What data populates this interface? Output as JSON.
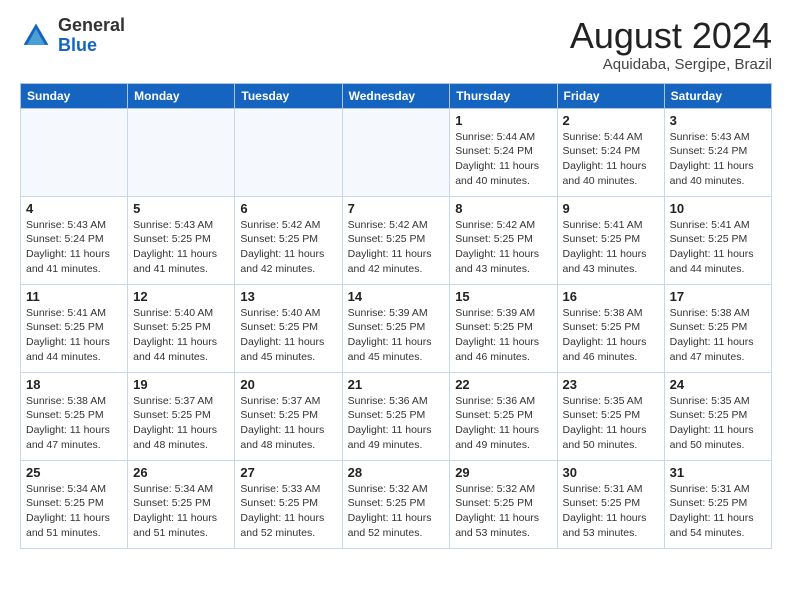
{
  "logo": {
    "general": "General",
    "blue": "Blue"
  },
  "header": {
    "month": "August 2024",
    "location": "Aquidaba, Sergipe, Brazil"
  },
  "weekdays": [
    "Sunday",
    "Monday",
    "Tuesday",
    "Wednesday",
    "Thursday",
    "Friday",
    "Saturday"
  ],
  "weeks": [
    [
      {
        "day": "",
        "info": ""
      },
      {
        "day": "",
        "info": ""
      },
      {
        "day": "",
        "info": ""
      },
      {
        "day": "",
        "info": ""
      },
      {
        "day": "1",
        "info": "Sunrise: 5:44 AM\nSunset: 5:24 PM\nDaylight: 11 hours\nand 40 minutes."
      },
      {
        "day": "2",
        "info": "Sunrise: 5:44 AM\nSunset: 5:24 PM\nDaylight: 11 hours\nand 40 minutes."
      },
      {
        "day": "3",
        "info": "Sunrise: 5:43 AM\nSunset: 5:24 PM\nDaylight: 11 hours\nand 40 minutes."
      }
    ],
    [
      {
        "day": "4",
        "info": "Sunrise: 5:43 AM\nSunset: 5:24 PM\nDaylight: 11 hours\nand 41 minutes."
      },
      {
        "day": "5",
        "info": "Sunrise: 5:43 AM\nSunset: 5:25 PM\nDaylight: 11 hours\nand 41 minutes."
      },
      {
        "day": "6",
        "info": "Sunrise: 5:42 AM\nSunset: 5:25 PM\nDaylight: 11 hours\nand 42 minutes."
      },
      {
        "day": "7",
        "info": "Sunrise: 5:42 AM\nSunset: 5:25 PM\nDaylight: 11 hours\nand 42 minutes."
      },
      {
        "day": "8",
        "info": "Sunrise: 5:42 AM\nSunset: 5:25 PM\nDaylight: 11 hours\nand 43 minutes."
      },
      {
        "day": "9",
        "info": "Sunrise: 5:41 AM\nSunset: 5:25 PM\nDaylight: 11 hours\nand 43 minutes."
      },
      {
        "day": "10",
        "info": "Sunrise: 5:41 AM\nSunset: 5:25 PM\nDaylight: 11 hours\nand 44 minutes."
      }
    ],
    [
      {
        "day": "11",
        "info": "Sunrise: 5:41 AM\nSunset: 5:25 PM\nDaylight: 11 hours\nand 44 minutes."
      },
      {
        "day": "12",
        "info": "Sunrise: 5:40 AM\nSunset: 5:25 PM\nDaylight: 11 hours\nand 44 minutes."
      },
      {
        "day": "13",
        "info": "Sunrise: 5:40 AM\nSunset: 5:25 PM\nDaylight: 11 hours\nand 45 minutes."
      },
      {
        "day": "14",
        "info": "Sunrise: 5:39 AM\nSunset: 5:25 PM\nDaylight: 11 hours\nand 45 minutes."
      },
      {
        "day": "15",
        "info": "Sunrise: 5:39 AM\nSunset: 5:25 PM\nDaylight: 11 hours\nand 46 minutes."
      },
      {
        "day": "16",
        "info": "Sunrise: 5:38 AM\nSunset: 5:25 PM\nDaylight: 11 hours\nand 46 minutes."
      },
      {
        "day": "17",
        "info": "Sunrise: 5:38 AM\nSunset: 5:25 PM\nDaylight: 11 hours\nand 47 minutes."
      }
    ],
    [
      {
        "day": "18",
        "info": "Sunrise: 5:38 AM\nSunset: 5:25 PM\nDaylight: 11 hours\nand 47 minutes."
      },
      {
        "day": "19",
        "info": "Sunrise: 5:37 AM\nSunset: 5:25 PM\nDaylight: 11 hours\nand 48 minutes."
      },
      {
        "day": "20",
        "info": "Sunrise: 5:37 AM\nSunset: 5:25 PM\nDaylight: 11 hours\nand 48 minutes."
      },
      {
        "day": "21",
        "info": "Sunrise: 5:36 AM\nSunset: 5:25 PM\nDaylight: 11 hours\nand 49 minutes."
      },
      {
        "day": "22",
        "info": "Sunrise: 5:36 AM\nSunset: 5:25 PM\nDaylight: 11 hours\nand 49 minutes."
      },
      {
        "day": "23",
        "info": "Sunrise: 5:35 AM\nSunset: 5:25 PM\nDaylight: 11 hours\nand 50 minutes."
      },
      {
        "day": "24",
        "info": "Sunrise: 5:35 AM\nSunset: 5:25 PM\nDaylight: 11 hours\nand 50 minutes."
      }
    ],
    [
      {
        "day": "25",
        "info": "Sunrise: 5:34 AM\nSunset: 5:25 PM\nDaylight: 11 hours\nand 51 minutes."
      },
      {
        "day": "26",
        "info": "Sunrise: 5:34 AM\nSunset: 5:25 PM\nDaylight: 11 hours\nand 51 minutes."
      },
      {
        "day": "27",
        "info": "Sunrise: 5:33 AM\nSunset: 5:25 PM\nDaylight: 11 hours\nand 52 minutes."
      },
      {
        "day": "28",
        "info": "Sunrise: 5:32 AM\nSunset: 5:25 PM\nDaylight: 11 hours\nand 52 minutes."
      },
      {
        "day": "29",
        "info": "Sunrise: 5:32 AM\nSunset: 5:25 PM\nDaylight: 11 hours\nand 53 minutes."
      },
      {
        "day": "30",
        "info": "Sunrise: 5:31 AM\nSunset: 5:25 PM\nDaylight: 11 hours\nand 53 minutes."
      },
      {
        "day": "31",
        "info": "Sunrise: 5:31 AM\nSunset: 5:25 PM\nDaylight: 11 hours\nand 54 minutes."
      }
    ]
  ]
}
